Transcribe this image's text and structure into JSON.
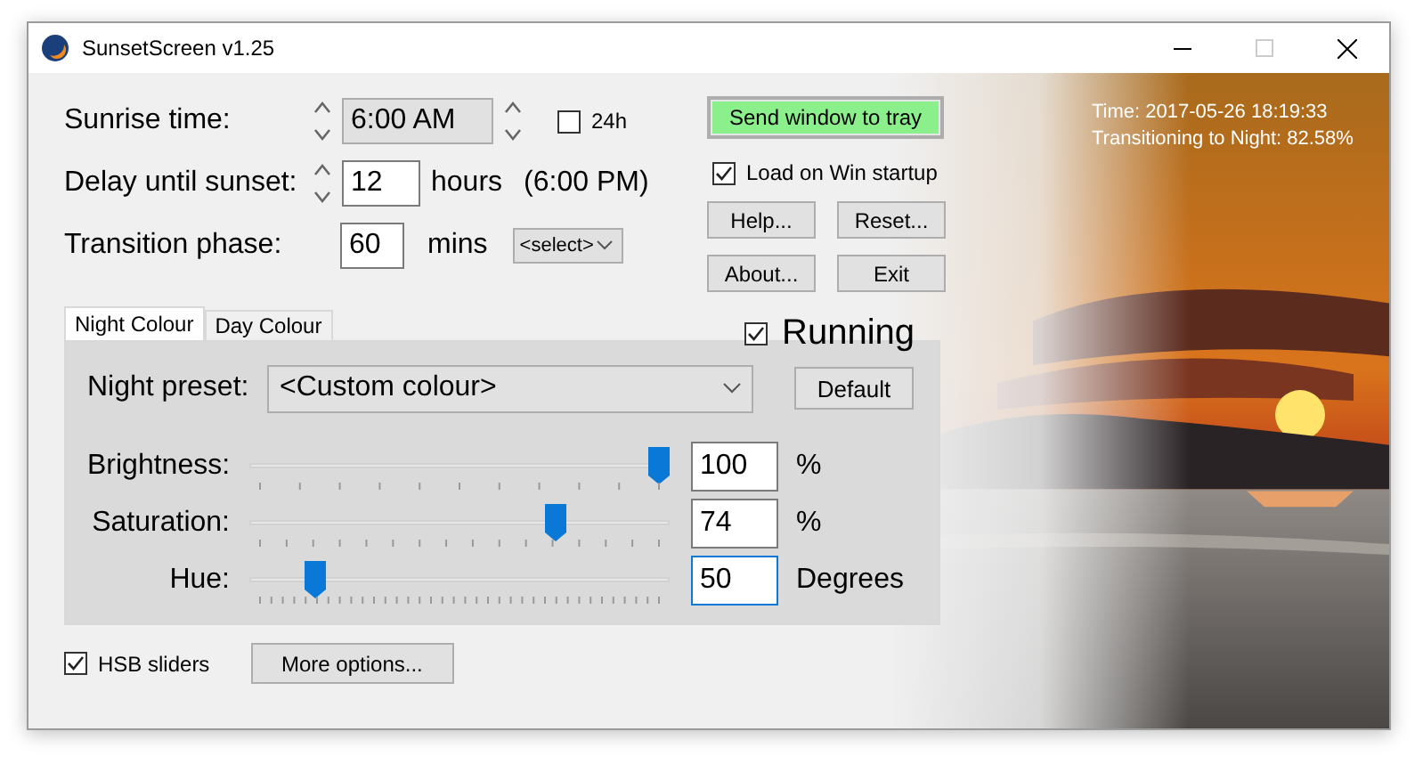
{
  "window": {
    "title": "SunsetScreen v1.25"
  },
  "sunrise": {
    "label": "Sunrise time:",
    "value": "6:00 AM"
  },
  "clock_24h": {
    "label": "24h",
    "checked": false
  },
  "delay": {
    "label": "Delay until sunset:",
    "value": "12",
    "unit": "hours",
    "result": "(6:00 PM)"
  },
  "transition": {
    "label": "Transition phase:",
    "value": "60",
    "unit": "mins",
    "select": "<select>"
  },
  "tray_button": "Send window to tray",
  "startup": {
    "label": "Load on Win startup",
    "checked": true
  },
  "buttons": [
    "Help...",
    "Reset...",
    "About...",
    "Exit"
  ],
  "running": {
    "label": "Running",
    "checked": true
  },
  "tabs": [
    {
      "label": "Night Colour",
      "selected": true
    },
    {
      "label": "Day Colour",
      "selected": false
    }
  ],
  "preset": {
    "label": "Night preset:",
    "value": "<Custom colour>",
    "button": "Default"
  },
  "sliders": [
    {
      "label": "Brightness:",
      "value": "100",
      "unit": "%",
      "level": 1.0,
      "focused": false
    },
    {
      "label": "Saturation:",
      "value": "74",
      "unit": "%",
      "level": 0.74,
      "focused": false
    },
    {
      "label": "Hue:",
      "value": "50",
      "unit": "Degrees",
      "level": 0.14,
      "focused": true
    }
  ],
  "hsb": {
    "label": "HSB sliders",
    "checked": true
  },
  "more_button": "More options...",
  "status": {
    "time": "Time: 2017-05-26 18:19:33",
    "transition": "Transitioning to Night: 82.58%"
  }
}
